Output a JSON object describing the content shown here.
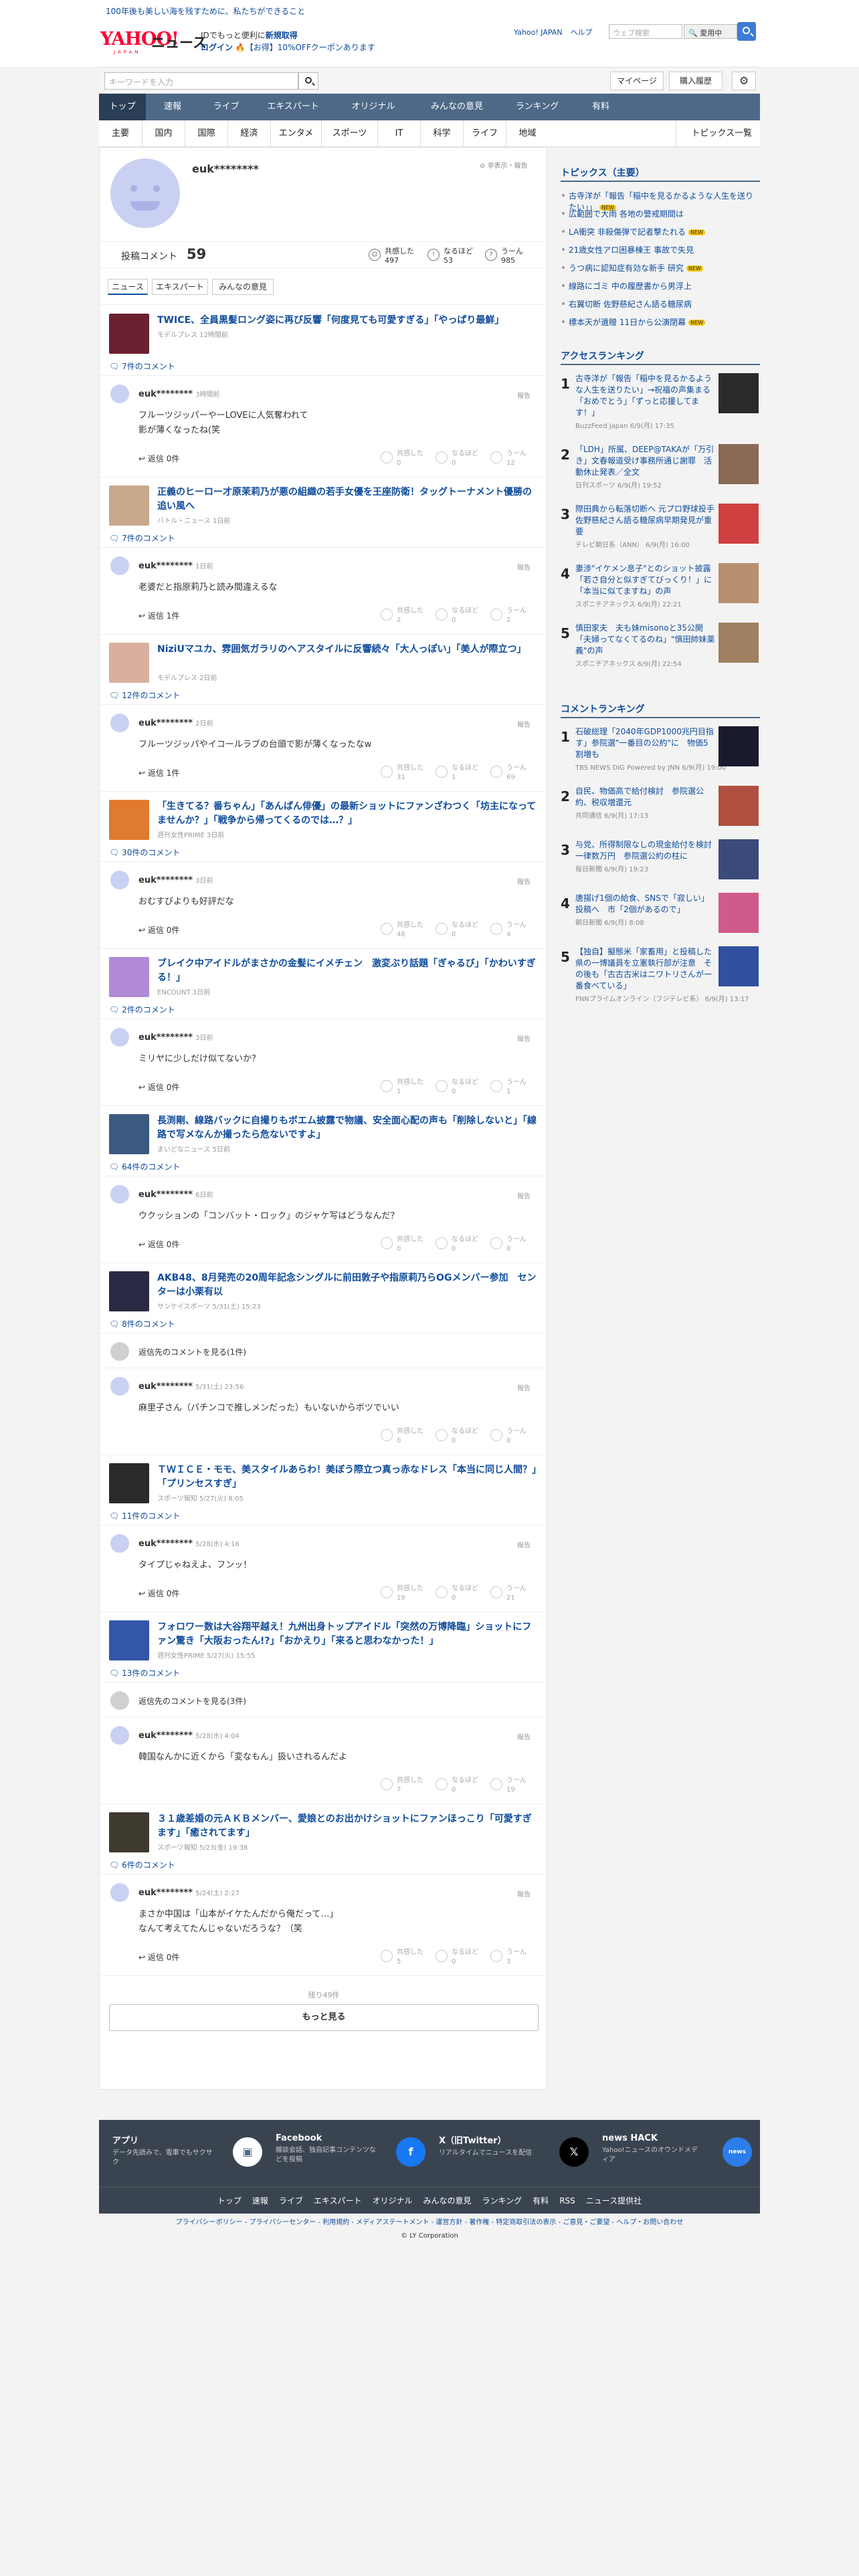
{
  "top_strip": {
    "link": "100年後も美しい海を残すために、私たちができること"
  },
  "header": {
    "logo_text": "YAHOO!",
    "logo_sub": "JAPAN",
    "section": "ニュース",
    "promo_line1_pre": "IDでもっと便利に",
    "promo_line1_link": "新規取得",
    "promo_line2_link": "ログイン",
    "promo_line2_text": "【お得】10%OFFクーポンあります",
    "links": [
      "Yahoo! JAPAN",
      "ヘルプ"
    ],
    "web_search_placeholder": "ウェブ検索",
    "web_search_button": "🔍 愛用中"
  },
  "search": {
    "placeholder": "キーワードを入力",
    "mypage": "マイページ",
    "history": "購入履歴"
  },
  "global_nav": [
    "トップ",
    "速報",
    "ライブ",
    "エキスパート",
    "オリジナル",
    "みんなの意見",
    "ランキング",
    "有料"
  ],
  "categories": [
    "主要",
    "国内",
    "国際",
    "経済",
    "エンタメ",
    "スポーツ",
    "IT",
    "科学",
    "ライフ",
    "地域"
  ],
  "categories_all": "トピックス一覧",
  "profile": {
    "name": "euk********",
    "report": "非表示・報告",
    "comments_label": "投稿コメント",
    "comments_count": "59",
    "stats": [
      {
        "label": "共感した",
        "value": "497"
      },
      {
        "label": "なるほど",
        "value": "53"
      },
      {
        "label": "うーん",
        "value": "985"
      }
    ],
    "tabs": [
      "ニュース",
      "エキスパート",
      "みんなの意見"
    ]
  },
  "reaction_labels": [
    "共感した",
    "なるほど",
    "うーん"
  ],
  "entries": [
    {
      "title": "TWICE、全員黒髪ロング姿に再び反響「何度見ても可愛すぎる」「やっぱり最鮮」",
      "source": "モデルプレス 12時間前",
      "comment_count": "7件のコメント",
      "user": "euk********",
      "time": "3時間前",
      "text": "フルーツジッパーやーLOVEに人気奪われて\n影が薄くなったね(笑",
      "reply": "返信 0件",
      "r": [
        "0",
        "0",
        "12"
      ]
    },
    {
      "title": "正義のヒーロー才原茉莉乃が悪の組織の若手女優を王座防衛！タッグトーナメント優勝の追い風へ",
      "source": "バトル・ニュース 1日前",
      "comment_count": "7件のコメント",
      "user": "euk********",
      "time": "1日前",
      "text": "老婆だと指原莉乃と読み間違えるな",
      "reply": "返信 1件",
      "r": [
        "2",
        "0",
        "2"
      ]
    },
    {
      "title": "NiziUマユカ、雰囲気ガラリのヘアスタイルに反響続々「大人っぽい」「美人が際立つ」",
      "source": "モデルプレス 2日前",
      "comment_count": "12件のコメント",
      "user": "euk********",
      "time": "2日前",
      "text": "フルーツジッパやイコールラブの台頭で影が薄くなったなw",
      "reply": "返信 1件",
      "r": [
        "31",
        "1",
        "69"
      ]
    },
    {
      "title": "「生きてる？番ちゃん」「あんぱん俳優」の最新ショットにファンざわつく「坊主になってませんか？」「戦争から帰ってくるのでは…？」",
      "source": "週刊女性PRIME 3日前",
      "comment_count": "30件のコメント",
      "user": "euk********",
      "time": "3日前",
      "text": "おむすびよりも好評だな",
      "reply": "返信 0件",
      "r": [
        "48",
        "0",
        "4"
      ]
    },
    {
      "title": "ブレイク中アイドルがまさかの金髪にイメチェン　激変ぶり話題「ぎゃるび」「かわいすぎる！」",
      "source": "ENCOUNT 3日前",
      "comment_count": "2件のコメント",
      "user": "euk********",
      "time": "3日前",
      "text": "ミリヤに少しだけ似てないか？",
      "reply": "返信 0件",
      "r": [
        "1",
        "0",
        "1"
      ]
    },
    {
      "title": "長渕剛、線路バックに自撮りもボエム披露で物議、安全面心配の声も「削除しないと」「線路で写メなんか撮ったら危ないですよ」",
      "source": "まいどなニュース 5日前",
      "comment_count": "64件のコメント",
      "user": "euk********",
      "time": "6日前",
      "text": "ウクッションの「コンバット・ロック」のジャケ写はどうなんだ？",
      "reply": "返信 0件",
      "r": [
        "0",
        "0",
        "0"
      ]
    },
    {
      "title": "AKB48、8月発売の20周年記念シングルに前田敦子や指原莉乃らOGメンバー参加　センターは小栗有以",
      "source": "サンケイスポーツ 5/31(土) 15:23",
      "comment_count": "8件のコメント",
      "prev": "返信先のコメントを見る(1件)",
      "user": "euk********",
      "time": "5/31(土) 23:56",
      "text": "麻里子さん（パチンコで推しメンだった）もいないからボツでいい",
      "reply": "",
      "r": [
        "0",
        "0",
        "0"
      ]
    },
    {
      "title": "ＴＷＩＣＥ・モモ、美スタイルあらわ！美ぼう際立つ真っ赤なドレス「本当に同じ人間？」「プリンセスすぎ」",
      "source": "スポーツ報知 5/27(火) 8:05",
      "comment_count": "11件のコメント",
      "user": "euk********",
      "time": "5/28(水) 4:16",
      "text": "タイプじゃねえよ、フンッ！",
      "reply": "返信 0件",
      "r": [
        "19",
        "0",
        "21"
      ]
    },
    {
      "title": "フォロワー数は大谷翔平越え！九州出身トップアイドル「突然の万博降臨」ショットにファン驚き「大阪おったん!?」「おかえり」「来ると思わなかった！」",
      "source": "週刊女性PRIME 5/27(火) 15:55",
      "comment_count": "13件のコメント",
      "prev": "返信先のコメントを見る(3件)",
      "user": "euk********",
      "time": "5/28(水) 4:04",
      "text": "韓国なんかに近くから「変なもん」扱いされるんだよ",
      "reply": "",
      "r": [
        "7",
        "0",
        "19"
      ]
    },
    {
      "title": "３１歳差婚の元ＡＫＢメンバー、愛娘とのお出かけショットにファンほっこり「可愛すぎます」「癒されてます」",
      "source": "スポーツ報知 5/23(金) 19:38",
      "comment_count": "6件のコメント",
      "user": "euk********",
      "time": "5/24(土) 2:27",
      "text": "まさか中国は「山本がイケたんだから俺だって…」\nなんて考えてたんじゃないだろうな？（笑",
      "reply": "返信 0件",
      "r": [
        "5",
        "0",
        "3"
      ]
    }
  ],
  "remaining": "残り49件",
  "more_button": "もっと見る",
  "sidebar": {
    "topics_title": "トピックス（主要）",
    "topics": [
      {
        "text": "古寺洋が「報告「稲中を見るかるような人生を送りたい」」",
        "new": true
      },
      {
        "text": "広範囲で大雨 各地の警戒期間は",
        "new": false
      },
      {
        "text": "LA衝突 非殺傷弾で記者撃たれる",
        "new": true
      },
      {
        "text": "21歳女性アロ困暴棟王 事故で失見",
        "new": false
      },
      {
        "text": "うつ病に認知症有効な新手 研究",
        "new": true
      },
      {
        "text": "線路にゴミ 中の履歴書から男浮上",
        "new": false
      },
      {
        "text": "右翼切断 佐野慈紀さん語る糖尿病",
        "new": false
      },
      {
        "text": "標本天が遺贈 11日から公演閉幕",
        "new": true
      }
    ],
    "new_tag": "NEW",
    "access_title": "アクセスランキング",
    "access": [
      {
        "n": "1",
        "t": "古寺洋が「報告「稲中を見るかるような人生を送りたい」→祝福の声集まる「おめでとう」「ずっと応援してます！」",
        "s": "BuzzFeed Japan 6/9(月) 17:35"
      },
      {
        "n": "2",
        "t": "「LDH」所属、DEEP@TAKAが「万引き」文春報道受け事務所通じ謝罪　活動休止発表／全文",
        "s": "日刊スポーツ 6/9(月) 19:52"
      },
      {
        "n": "3",
        "t": "際田典から転落切断へ 元プロ野球投手 佐野慈紀さん語る糖尿病早期発見が重要",
        "s": "テレビ朝日系（ANN） 6/9(月) 16:00"
      },
      {
        "n": "4",
        "t": "妻渉\"イケメン息子\"とのショット披露「若さ自分と似すぎてびっくり！」に「本当に似てますね」の声",
        "s": "スポニチアネックス 6/9(月) 22:21"
      },
      {
        "n": "5",
        "t": "慎田家夫　夫も妹misonoと35公開「夫婦ってなくてるのね」\"慎田帥妹薬義\"の声",
        "s": "スポニチアネックス 6/9(月) 22:54"
      }
    ],
    "comment_title": "コメントランキング",
    "comment": [
      {
        "n": "1",
        "t": "石破総理「2040年GDP1000兆円目指す」参院選\"一番目の公約\"に　物価5割増も",
        "s": "TBS NEWS DIG Powered by JNN 6/9(月) 19:00"
      },
      {
        "n": "2",
        "t": "自民、物価高で給付検討　参院選公約、税収増還元",
        "s": "共同通信 6/9(月) 17:13"
      },
      {
        "n": "3",
        "t": "与党、所得制限なしの現金給付を検討　一律数万円　参院選公約の柱に",
        "s": "毎日新聞 6/9(月) 19:23"
      },
      {
        "n": "4",
        "t": "唐揚げ1個の給食、SNSで「寂しい」投稿へ　市「2個があるので」",
        "s": "朝日新聞 6/9(月) 8:08"
      },
      {
        "n": "5",
        "t": "【独自】擬態米「家畜用」と投稿した県の一博議員を立憲執行部が注意　その後も「古古古米はニワトリさんが一番食べている」",
        "s": "FNNプライムオンライン（フジテレビ系） 6/9(月) 13:17"
      }
    ]
  },
  "footer": {
    "apps": [
      {
        "title": "アプリ",
        "desc": "データ先読みで、電車でもサクサク",
        "icon": "app-icon"
      },
      {
        "title": "Facebook",
        "desc": "雑談会話、独自記事コンテンツなどを投稿",
        "icon": "facebook-icon"
      },
      {
        "title": "X（旧Twitter）",
        "desc": "リアルタイムでニュースを配信",
        "icon": "x-icon"
      },
      {
        "title": "news HACK",
        "desc": "Yahoo!ニュースのオウンドメディア",
        "icon": "newshack-icon"
      }
    ],
    "nav": [
      "トップ",
      "速報",
      "ライブ",
      "エキスパート",
      "オリジナル",
      "みんなの意見",
      "ランキング",
      "有料",
      "RSS",
      "ニュース提供社"
    ],
    "legal": "プライバシーポリシー - プライバシーセンター - 利用規約 - メディアステートメント - 運営方針 - 著作権 - 特定商取引法の表示 - ご意見・ご要望 - ヘルプ・お問い合わせ",
    "copyright": "© LY Corporation"
  },
  "colors": {
    "accent": "#0f4c9c",
    "nav": "#4d6987",
    "new_tag": "#f5c400",
    "brand": "#ff0033"
  }
}
